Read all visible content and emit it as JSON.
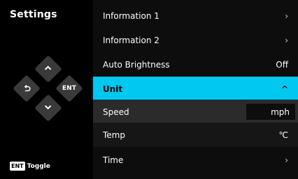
{
  "sidebar": {
    "title": "Settings",
    "dpad": {
      "up_icon": "chevron-up-icon",
      "down_icon": "chevron-down-icon",
      "back_icon": "back-arrow-icon",
      "ent_label": "ENT"
    },
    "hint": {
      "badge": "ENT",
      "label": "Toggle"
    }
  },
  "menu": {
    "items": [
      {
        "label": "Information 1",
        "value": "",
        "chevron": "›"
      },
      {
        "label": "Information 2",
        "value": "",
        "chevron": "›"
      },
      {
        "label": "Auto Brightness",
        "value": "Off",
        "chevron": ""
      },
      {
        "label": "Unit",
        "value": "",
        "chevron": "^"
      },
      {
        "label": "Speed",
        "value": "mph",
        "chevron": ""
      },
      {
        "label": "Temp",
        "value": "℃",
        "chevron": ""
      },
      {
        "label": "Time",
        "value": "",
        "chevron": "›"
      }
    ]
  },
  "colors": {
    "accent": "#00c8f0",
    "background": "#0d0d0d",
    "button": "#3a3a3a"
  }
}
